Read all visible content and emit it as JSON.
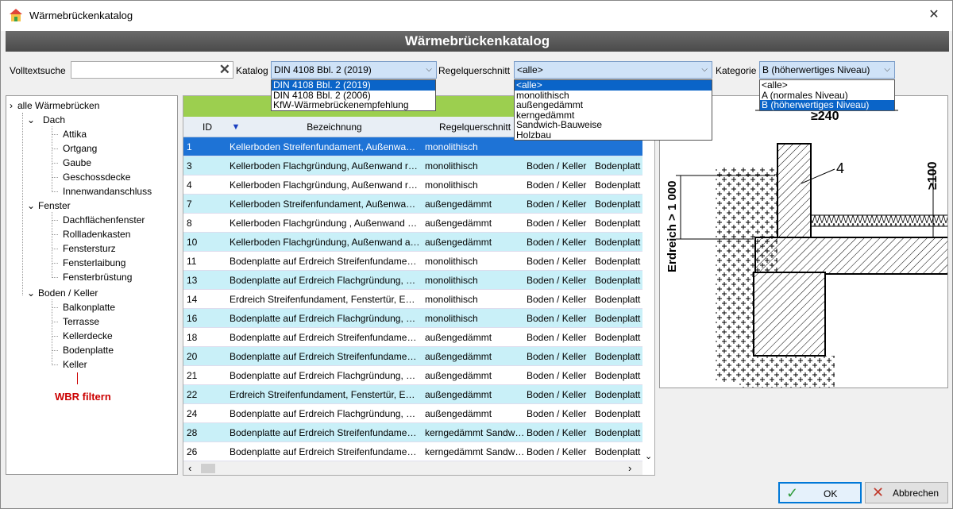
{
  "window": {
    "title": "Wärmebrückenkatalog",
    "close_glyph": "✕"
  },
  "banner": {
    "title": "Wärmebrückenkatalog"
  },
  "filters": {
    "fulltext_label": "Volltextsuche",
    "fulltext_value": "",
    "catalog_label": "Katalog",
    "catalog_value": "DIN 4108 Bbl. 2 (2019)",
    "catalog_options": [
      "DIN 4108 Bbl. 2 (2019)",
      "DIN 4108 Bbl. 2 (2006)",
      "KfW-Wärmebrückenempfehlung"
    ],
    "regel_label": "Regelquerschnitt",
    "regel_value": "<alle>",
    "regel_options": [
      "<alle>",
      "monolithisch",
      "außengedämmt",
      "kerngedämmt",
      "Sandwich-Bauweise",
      "Holzbau"
    ],
    "kategorie_label": "Kategorie",
    "kategorie_value": "B (höherwertiges Niveau)",
    "kategorie_options": [
      "<alle>",
      "A (normales Niveau)",
      "B (höherwertiges Niveau)"
    ]
  },
  "tree": {
    "root": "alle Wärmebrücken",
    "groups": [
      {
        "label": "Dach",
        "items": [
          "Attika",
          "Ortgang",
          "Gaube",
          "Geschossdecke",
          "Innenwandanschluss"
        ]
      },
      {
        "label": "Fenster",
        "items": [
          "Dachflächenfenster",
          "Rollladenkasten",
          "Fenstersturz",
          "Fensterlaibung",
          "Fensterbrüstung"
        ]
      },
      {
        "label": "Boden / Keller",
        "items": [
          "Balkonplatte",
          "Terrasse",
          "Kellerdecke",
          "Bodenplatte",
          "Keller"
        ]
      }
    ],
    "annotation": "WBR filtern"
  },
  "table": {
    "columns": [
      "ID",
      "Bezeichnung",
      "Regelquerschnitt"
    ],
    "sort_indicator": "▼",
    "rows": [
      [
        "1",
        "Kellerboden Streifenfundament, Außenwa…",
        "monolithisch",
        "",
        ""
      ],
      [
        "3",
        "Kellerboden Flachgründung, Außenwand r…",
        "monolithisch",
        "Boden / Keller",
        "Bodenplatt"
      ],
      [
        "4",
        "Kellerboden Flachgründung, Außenwand r…",
        "monolithisch",
        "Boden / Keller",
        "Bodenplatt"
      ],
      [
        "7",
        "Kellerboden Streifenfundament, Außenwa…",
        "außengedämmt",
        "Boden / Keller",
        "Bodenplatt"
      ],
      [
        "8",
        "Kellerboden Flachgründung , Außenwand …",
        "außengedämmt",
        "Boden / Keller",
        "Bodenplatt"
      ],
      [
        "10",
        "Kellerboden Flachgründung, Außenwand a…",
        "außengedämmt",
        "Boden / Keller",
        "Bodenplatt"
      ],
      [
        "11",
        "Bodenplatte auf Erdreich Streifenfundame…",
        "monolithisch",
        "Boden / Keller",
        "Bodenplatt"
      ],
      [
        "13",
        "Bodenplatte auf Erdreich Flachgründung, …",
        "monolithisch",
        "Boden / Keller",
        "Bodenplatt"
      ],
      [
        "14",
        "Erdreich Streifenfundament, Fenstertür, E…",
        "monolithisch",
        "Boden / Keller",
        "Bodenplatt"
      ],
      [
        "16",
        "Bodenplatte auf Erdreich Flachgründung, …",
        "monolithisch",
        "Boden / Keller",
        "Bodenplatt"
      ],
      [
        "18",
        "Bodenplatte auf Erdreich Streifenfundame…",
        "außengedämmt",
        "Boden / Keller",
        "Bodenplatt"
      ],
      [
        "20",
        "Bodenplatte auf Erdreich Streifenfundame…",
        "außengedämmt",
        "Boden / Keller",
        "Bodenplatt"
      ],
      [
        "21",
        "Bodenplatte auf Erdreich Flachgründung, …",
        "außengedämmt",
        "Boden / Keller",
        "Bodenplatt"
      ],
      [
        "22",
        "Erdreich Streifenfundament, Fenstertür, E…",
        "außengedämmt",
        "Boden / Keller",
        "Bodenplatt"
      ],
      [
        "24",
        "Bodenplatte auf Erdreich Flachgründung, …",
        "außengedämmt",
        "Boden / Keller",
        "Bodenplatt"
      ],
      [
        "28",
        "Bodenplatte auf Erdreich Streifenfundame…",
        "kerngedämmt Sandw…",
        "Boden / Keller",
        "Bodenplatt"
      ],
      [
        "26",
        "Bodenplatte auf Erdreich Streifenfundame…",
        "kerngedämmt Sandw…",
        "Boden / Keller",
        "Bodenplatt"
      ]
    ]
  },
  "drawing": {
    "dim1": "≥240",
    "dim2": "≥100",
    "label_side": "Erdreich > 1 000",
    "callout": "4"
  },
  "buttons": {
    "ok": "OK",
    "cancel": "Abbrechen"
  },
  "colors": {
    "accent_green": "#9ccf4f",
    "row_alt": "#c9f0f8",
    "selection": "#1e73d6",
    "annotation_red": "#cc0000"
  }
}
